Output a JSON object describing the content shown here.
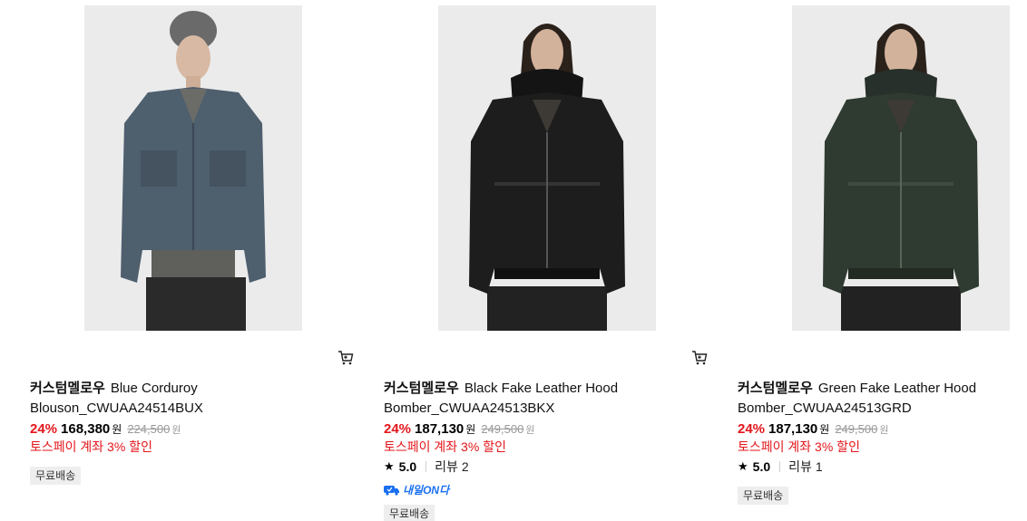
{
  "products": [
    {
      "brand": "커스텀멜로우",
      "name": "Blue Corduroy Blouson_CWUAA24514BUX",
      "discount": "24%",
      "price": "168,380",
      "price_unit": "원",
      "original_price": "224,500",
      "original_unit": "원",
      "promo": "토스페이 계좌 3% 할인",
      "shipping_tag": "무료배송",
      "colors": {
        "jacket": "#4e5f6e"
      }
    },
    {
      "brand": "커스텀멜로우",
      "name": "Black Fake Leather Hood Bomber_CWUAA24513BKX",
      "discount": "24%",
      "price": "187,130",
      "price_unit": "원",
      "original_price": "249,500",
      "original_unit": "원",
      "promo": "토스페이 계좌 3% 할인",
      "rating": "5.0",
      "review_label": "리뷰",
      "review_count": "2",
      "delivery_badge": "내일ON다",
      "shipping_tag": "무료배송",
      "colors": {
        "jacket": "#1c1d1c"
      }
    },
    {
      "brand": "커스텀멜로우",
      "name": "Green Fake Leather Hood Bomber_CWUAA24513GRD",
      "discount": "24%",
      "price": "187,130",
      "price_unit": "원",
      "original_price": "249,500",
      "original_unit": "원",
      "promo": "토스페이 계좌 3% 할인",
      "rating": "5.0",
      "review_label": "리뷰",
      "review_count": "1",
      "shipping_tag": "무료배송",
      "colors": {
        "jacket": "#2f3a30"
      }
    }
  ],
  "icons": {
    "cart": "cart-icon",
    "star": "star-icon",
    "delivery": "delivery-truck-icon"
  },
  "theme": {
    "discount_color": "#e4161b",
    "delivery_color": "#1a6ff2"
  }
}
